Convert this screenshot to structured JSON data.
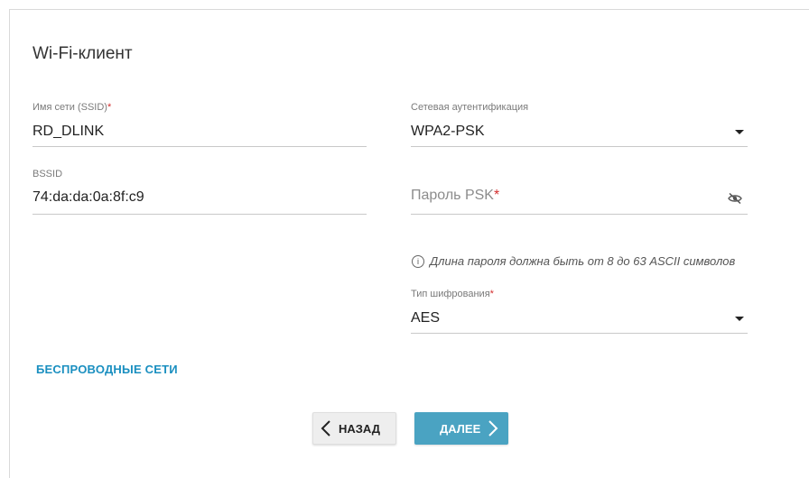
{
  "page": {
    "title": "Wi-Fi-клиент"
  },
  "left": {
    "ssid": {
      "label": "Имя сети (SSID)",
      "required_mark": "*",
      "value": "RD_DLINK"
    },
    "bssid": {
      "label": "BSSID",
      "value": "74:da:da:0a:8f:c9"
    }
  },
  "right": {
    "auth": {
      "label": "Сетевая аутентификация",
      "value": "WPA2-PSK"
    },
    "psk": {
      "placeholder": "Пароль PSK",
      "required_mark": "*",
      "value": ""
    },
    "hint": {
      "icon": "info-icon",
      "text": "Длина пароля должна быть от 8 до 63 ASCII символов"
    },
    "encryption": {
      "label": "Тип шифрования",
      "required_mark": "*",
      "value": "AES"
    }
  },
  "links": {
    "wireless_networks": "БЕСПРОВОДНЫЕ СЕТИ"
  },
  "buttons": {
    "back": "НАЗАД",
    "next": "ДАЛЕЕ"
  },
  "colors": {
    "accent": "#4aa3c2",
    "link": "#1a8fc0",
    "required": "#d32f2f"
  }
}
